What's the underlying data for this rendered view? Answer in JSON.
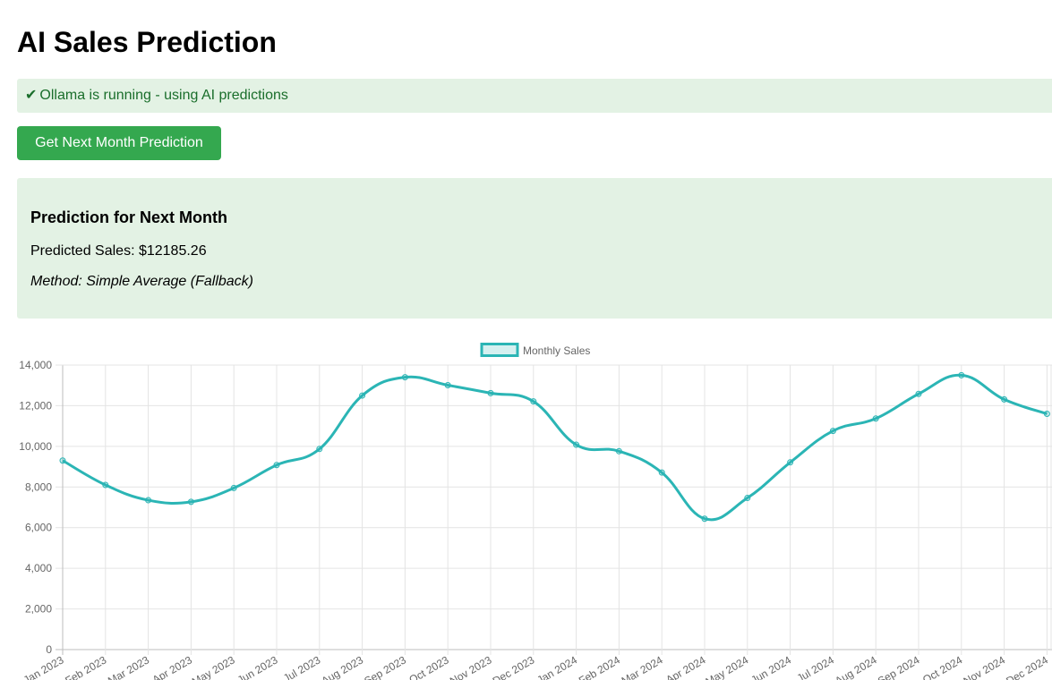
{
  "page": {
    "title": "AI Sales Prediction"
  },
  "status": {
    "icon": "check-icon",
    "check_glyph": "✔",
    "text": "Ollama is running - using AI predictions"
  },
  "actions": {
    "predict_button_label": "Get Next Month Prediction"
  },
  "prediction": {
    "heading": "Prediction for Next Month",
    "sales_text": "Predicted Sales: $12185.26",
    "method_text": "Method: Simple Average (Fallback)"
  },
  "colors": {
    "accent_green": "#34a84f",
    "panel_green": "#e3f2e4",
    "status_text": "#1a6e2b",
    "series_line": "#2bb5b5"
  },
  "chart_data": {
    "type": "line",
    "legend": "Monthly Sales",
    "legend_position": "top",
    "grid": true,
    "ylim": [
      0,
      14000
    ],
    "yticks": [
      "0",
      "2,000",
      "4,000",
      "6,000",
      "8,000",
      "10,000",
      "12,000",
      "14,000"
    ],
    "categories": [
      "Jan 2023",
      "Feb 2023",
      "Mar 2023",
      "Apr 2023",
      "May 2023",
      "Jun 2023",
      "Jul 2023",
      "Aug 2023",
      "Sep 2023",
      "Oct 2023",
      "Nov 2023",
      "Dec 2023",
      "Jan 2024",
      "Feb 2024",
      "Mar 2024",
      "Apr 2024",
      "May 2024",
      "Jun 2024",
      "Jul 2024",
      "Aug 2024",
      "Sep 2024",
      "Oct 2024",
      "Nov 2024",
      "Dec 2024"
    ],
    "series": [
      {
        "name": "Monthly Sales",
        "values": [
          9300,
          8100,
          7350,
          7270,
          7950,
          9080,
          9870,
          12500,
          13400,
          13010,
          12620,
          12210,
          10080,
          9760,
          8710,
          6440,
          7460,
          9210,
          10760,
          11370,
          12580,
          13500,
          12310,
          11600
        ]
      }
    ]
  }
}
